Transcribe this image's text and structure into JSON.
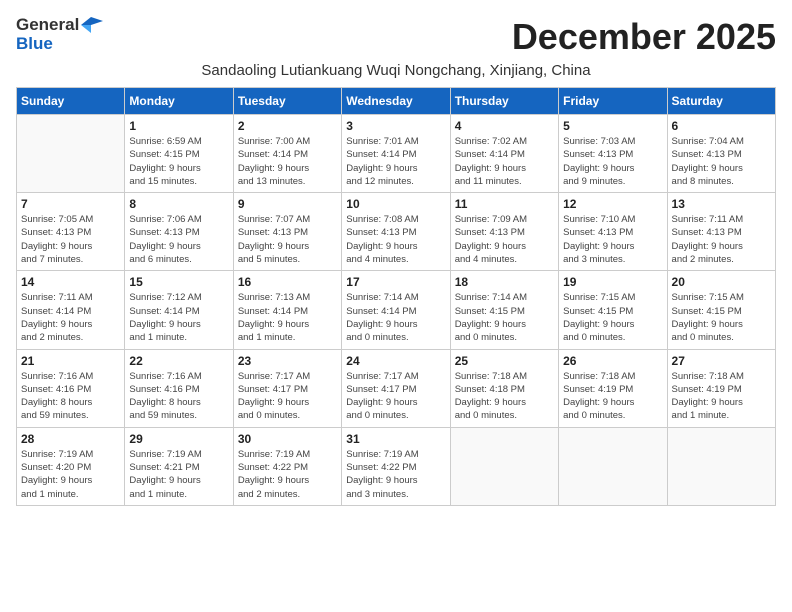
{
  "logo": {
    "text1": "General",
    "text2": "Blue"
  },
  "title": "December 2025",
  "subtitle": "Sandaoling Lutiankuang Wuqi Nongchang, Xinjiang, China",
  "days_of_week": [
    "Sunday",
    "Monday",
    "Tuesday",
    "Wednesday",
    "Thursday",
    "Friday",
    "Saturday"
  ],
  "weeks": [
    [
      {
        "day": "",
        "info": ""
      },
      {
        "day": "1",
        "info": "Sunrise: 6:59 AM\nSunset: 4:15 PM\nDaylight: 9 hours\nand 15 minutes."
      },
      {
        "day": "2",
        "info": "Sunrise: 7:00 AM\nSunset: 4:14 PM\nDaylight: 9 hours\nand 13 minutes."
      },
      {
        "day": "3",
        "info": "Sunrise: 7:01 AM\nSunset: 4:14 PM\nDaylight: 9 hours\nand 12 minutes."
      },
      {
        "day": "4",
        "info": "Sunrise: 7:02 AM\nSunset: 4:14 PM\nDaylight: 9 hours\nand 11 minutes."
      },
      {
        "day": "5",
        "info": "Sunrise: 7:03 AM\nSunset: 4:13 PM\nDaylight: 9 hours\nand 9 minutes."
      },
      {
        "day": "6",
        "info": "Sunrise: 7:04 AM\nSunset: 4:13 PM\nDaylight: 9 hours\nand 8 minutes."
      }
    ],
    [
      {
        "day": "7",
        "info": "Sunrise: 7:05 AM\nSunset: 4:13 PM\nDaylight: 9 hours\nand 7 minutes."
      },
      {
        "day": "8",
        "info": "Sunrise: 7:06 AM\nSunset: 4:13 PM\nDaylight: 9 hours\nand 6 minutes."
      },
      {
        "day": "9",
        "info": "Sunrise: 7:07 AM\nSunset: 4:13 PM\nDaylight: 9 hours\nand 5 minutes."
      },
      {
        "day": "10",
        "info": "Sunrise: 7:08 AM\nSunset: 4:13 PM\nDaylight: 9 hours\nand 4 minutes."
      },
      {
        "day": "11",
        "info": "Sunrise: 7:09 AM\nSunset: 4:13 PM\nDaylight: 9 hours\nand 4 minutes."
      },
      {
        "day": "12",
        "info": "Sunrise: 7:10 AM\nSunset: 4:13 PM\nDaylight: 9 hours\nand 3 minutes."
      },
      {
        "day": "13",
        "info": "Sunrise: 7:11 AM\nSunset: 4:13 PM\nDaylight: 9 hours\nand 2 minutes."
      }
    ],
    [
      {
        "day": "14",
        "info": "Sunrise: 7:11 AM\nSunset: 4:14 PM\nDaylight: 9 hours\nand 2 minutes."
      },
      {
        "day": "15",
        "info": "Sunrise: 7:12 AM\nSunset: 4:14 PM\nDaylight: 9 hours\nand 1 minute."
      },
      {
        "day": "16",
        "info": "Sunrise: 7:13 AM\nSunset: 4:14 PM\nDaylight: 9 hours\nand 1 minute."
      },
      {
        "day": "17",
        "info": "Sunrise: 7:14 AM\nSunset: 4:14 PM\nDaylight: 9 hours\nand 0 minutes."
      },
      {
        "day": "18",
        "info": "Sunrise: 7:14 AM\nSunset: 4:15 PM\nDaylight: 9 hours\nand 0 minutes."
      },
      {
        "day": "19",
        "info": "Sunrise: 7:15 AM\nSunset: 4:15 PM\nDaylight: 9 hours\nand 0 minutes."
      },
      {
        "day": "20",
        "info": "Sunrise: 7:15 AM\nSunset: 4:15 PM\nDaylight: 9 hours\nand 0 minutes."
      }
    ],
    [
      {
        "day": "21",
        "info": "Sunrise: 7:16 AM\nSunset: 4:16 PM\nDaylight: 8 hours\nand 59 minutes."
      },
      {
        "day": "22",
        "info": "Sunrise: 7:16 AM\nSunset: 4:16 PM\nDaylight: 8 hours\nand 59 minutes."
      },
      {
        "day": "23",
        "info": "Sunrise: 7:17 AM\nSunset: 4:17 PM\nDaylight: 9 hours\nand 0 minutes."
      },
      {
        "day": "24",
        "info": "Sunrise: 7:17 AM\nSunset: 4:17 PM\nDaylight: 9 hours\nand 0 minutes."
      },
      {
        "day": "25",
        "info": "Sunrise: 7:18 AM\nSunset: 4:18 PM\nDaylight: 9 hours\nand 0 minutes."
      },
      {
        "day": "26",
        "info": "Sunrise: 7:18 AM\nSunset: 4:19 PM\nDaylight: 9 hours\nand 0 minutes."
      },
      {
        "day": "27",
        "info": "Sunrise: 7:18 AM\nSunset: 4:19 PM\nDaylight: 9 hours\nand 1 minute."
      }
    ],
    [
      {
        "day": "28",
        "info": "Sunrise: 7:19 AM\nSunset: 4:20 PM\nDaylight: 9 hours\nand 1 minute."
      },
      {
        "day": "29",
        "info": "Sunrise: 7:19 AM\nSunset: 4:21 PM\nDaylight: 9 hours\nand 1 minute."
      },
      {
        "day": "30",
        "info": "Sunrise: 7:19 AM\nSunset: 4:22 PM\nDaylight: 9 hours\nand 2 minutes."
      },
      {
        "day": "31",
        "info": "Sunrise: 7:19 AM\nSunset: 4:22 PM\nDaylight: 9 hours\nand 3 minutes."
      },
      {
        "day": "",
        "info": ""
      },
      {
        "day": "",
        "info": ""
      },
      {
        "day": "",
        "info": ""
      }
    ]
  ]
}
